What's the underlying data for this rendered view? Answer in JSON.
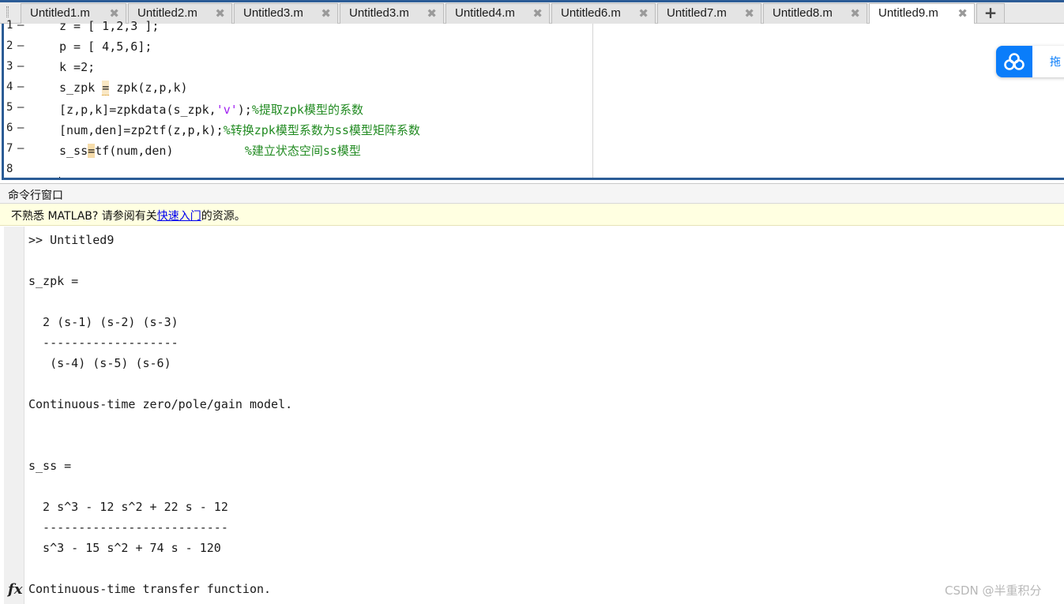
{
  "tabs": [
    {
      "label": "Untitled1.m",
      "close": "✖",
      "active": false
    },
    {
      "label": "Untitled2.m",
      "close": "✖",
      "active": false
    },
    {
      "label": "Untitled3.m",
      "close": "✖",
      "active": false
    },
    {
      "label": "Untitled3.m",
      "close": "✖",
      "active": false
    },
    {
      "label": "Untitled4.m",
      "close": "✖",
      "active": false
    },
    {
      "label": "Untitled6.m",
      "close": "✖",
      "active": false
    },
    {
      "label": "Untitled7.m",
      "close": "✖",
      "active": false
    },
    {
      "label": "Untitled8.m",
      "close": "✖",
      "active": false
    },
    {
      "label": "Untitled9.m",
      "close": "✖",
      "active": true
    }
  ],
  "add_tab_label": "+",
  "editor": {
    "line_marker": "—",
    "lines": [
      {
        "num": "1",
        "code": "z = [ 1,2,3 ];",
        "comment": ""
      },
      {
        "num": "2",
        "code": "p = [ 4,5,6];",
        "comment": ""
      },
      {
        "num": "3",
        "code": "k =2;",
        "comment": ""
      },
      {
        "num": "4",
        "code_a": "s_zpk ",
        "hl": "=",
        "code_b": " zpk(z,p,k)",
        "comment": ""
      },
      {
        "num": "5",
        "code_a": "[z,p,k]=zpkdata(s_zpk,",
        "str": "'v'",
        "code_b": ");",
        "comment": "%提取zpk模型的系数"
      },
      {
        "num": "6",
        "code": "[num,den]=zp2tf(z,p,k);",
        "comment": "%转换zpk模型系数为ss模型矩阵系数"
      },
      {
        "num": "7",
        "code_a": "s_ss",
        "hl": "=",
        "code_b": "tf(num,den)          ",
        "comment": "%建立状态空间ss模型"
      },
      {
        "num": "8",
        "code": "",
        "comment": ""
      }
    ]
  },
  "cloud_widget": {
    "text": "拖"
  },
  "command_window": {
    "title": "命令行窗口",
    "notice_before": "不熟悉 MATLAB? 请参阅有关",
    "notice_link": "快速入门",
    "notice_after": "的资源。",
    "output": [
      ">> Untitled9",
      "s_zpk =",
      "  2 (s-1) (s-2) (s-3)",
      "  -------------------",
      "   (s-4) (s-5) (s-6)",
      "Continuous-time zero/pole/gain model.",
      "s_ss =",
      "  2 s^3 - 12 s^2 + 22 s - 12",
      "  --------------------------",
      "  s^3 - 15 s^2 + 74 s - 120",
      "Continuous-time transfer function."
    ],
    "fx_label": "fx"
  },
  "watermark": "CSDN @半重积分",
  "colors": {
    "accent": "#2b5c96",
    "comment": "#228b22",
    "string": "#a020f0",
    "notice_bg": "#ffffe1",
    "link": "#0000ee"
  }
}
